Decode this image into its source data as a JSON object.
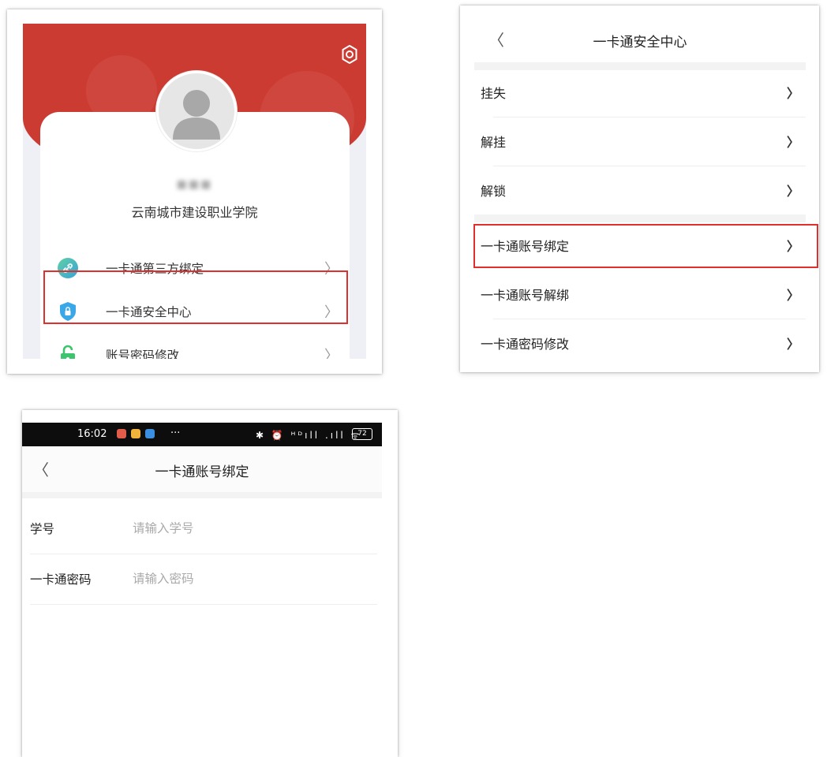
{
  "profile": {
    "username": "■■■",
    "school": "云南城市建设职业学院",
    "menu": [
      {
        "label": "一卡通第三方绑定",
        "icon": "link-icon",
        "color": "#43b89a"
      },
      {
        "label": "一卡通安全中心",
        "icon": "shield-lock-icon",
        "color": "#3aa7e8"
      },
      {
        "label": "账号密码修改",
        "icon": "padlock-icon",
        "color": "#3cc46e"
      }
    ],
    "arrow": "〉"
  },
  "security": {
    "title": "一卡通安全中心",
    "back": "〈",
    "arrow": "〉",
    "items": [
      {
        "label": "挂失"
      },
      {
        "label": "解挂"
      },
      {
        "label": "解锁"
      },
      {
        "label": "一卡通账号绑定"
      },
      {
        "label": "一卡通账号解绑"
      },
      {
        "label": "一卡通密码修改"
      }
    ]
  },
  "binding": {
    "status_time": "16:02",
    "status_dots": "···",
    "status_icons": "✱ ⏰ ᴴᴰıll .ıll ᯤ",
    "battery": "72",
    "title": "一卡通账号绑定",
    "back": "〈",
    "fields": [
      {
        "label": "学号",
        "placeholder": "请输入学号"
      },
      {
        "label": "一卡通密码",
        "placeholder": "请输入密码"
      }
    ]
  },
  "colors": {
    "header_red": "#cc3b32",
    "highlight_red": "#e0302e"
  }
}
